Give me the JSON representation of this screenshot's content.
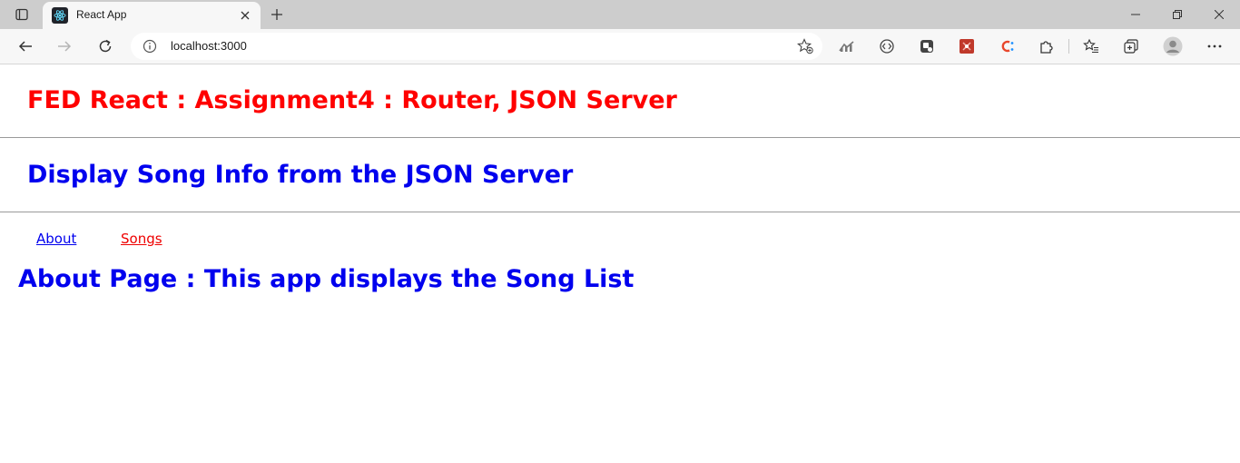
{
  "browser": {
    "tab": {
      "title": "React App"
    },
    "address_bar": {
      "url": "localhost:3000"
    }
  },
  "page": {
    "heading_main": "FED React : Assignment4 : Router, JSON Server",
    "heading_sub": "Display Song Info from the JSON Server",
    "nav": {
      "about_label": "About",
      "songs_label": "Songs"
    },
    "about_heading": "About Page : This app displays the Song List"
  },
  "colors": {
    "main_heading": "#ff0000",
    "sub_heading": "#0000ee",
    "link_about": "#0000ee",
    "link_songs": "#ee0000"
  }
}
